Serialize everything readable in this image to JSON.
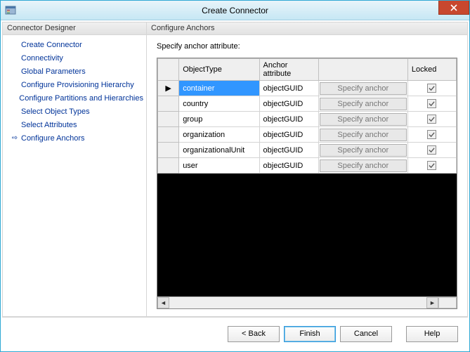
{
  "window": {
    "title": "Create Connector"
  },
  "left": {
    "header": "Connector Designer",
    "items": [
      {
        "label": "Create Connector",
        "current": false
      },
      {
        "label": "Connectivity",
        "current": false
      },
      {
        "label": "Global Parameters",
        "current": false
      },
      {
        "label": "Configure Provisioning Hierarchy",
        "current": false
      },
      {
        "label": "Configure Partitions and Hierarchies",
        "current": false
      },
      {
        "label": "Select Object Types",
        "current": false
      },
      {
        "label": "Select Attributes",
        "current": false
      },
      {
        "label": "Configure Anchors",
        "current": true
      }
    ]
  },
  "right": {
    "header": "Configure Anchors",
    "instruction": "Specify anchor attribute:"
  },
  "columns": {
    "objecttype": "ObjectType",
    "anchorattr": "Anchor attribute",
    "action": "",
    "locked": "Locked"
  },
  "specify_label": "Specify anchor",
  "rows": [
    {
      "marker": "▶",
      "objecttype": "container",
      "anchor": "objectGUID",
      "locked": true,
      "selected": true
    },
    {
      "marker": "",
      "objecttype": "country",
      "anchor": "objectGUID",
      "locked": true,
      "selected": false
    },
    {
      "marker": "",
      "objecttype": "group",
      "anchor": "objectGUID",
      "locked": true,
      "selected": false
    },
    {
      "marker": "",
      "objecttype": "organization",
      "anchor": "objectGUID",
      "locked": true,
      "selected": false
    },
    {
      "marker": "",
      "objecttype": "organizationalUnit",
      "anchor": "objectGUID",
      "locked": true,
      "selected": false
    },
    {
      "marker": "",
      "objecttype": "user",
      "anchor": "objectGUID",
      "locked": true,
      "selected": false
    }
  ],
  "buttons": {
    "back": "<  Back",
    "finish": "Finish",
    "cancel": "Cancel",
    "help": "Help"
  }
}
